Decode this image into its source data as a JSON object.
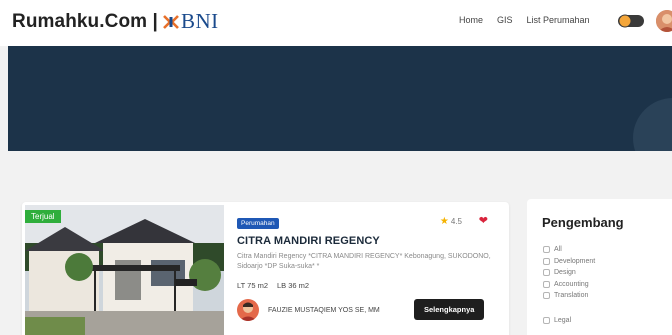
{
  "brand": {
    "name": "Rumahku.Com |",
    "partner": "BNI"
  },
  "nav": {
    "items": [
      "Home",
      "GIS",
      "List Perumahan"
    ]
  },
  "colors": {
    "hero": "#1c3349",
    "sold": "#2fae3c",
    "category": "#1f58b5",
    "button": "#1e1e1e",
    "heart": "#d9243c",
    "star": "#f5b301"
  },
  "listing": {
    "status": "Terjual",
    "category": "Perumahan",
    "rating": "4.5",
    "title": "CITRA MANDIRI REGENCY",
    "description": "Citra Mandiri Regency *CITRA MANDIRI REGENCY* Kebonagung, SUKODONO, Sidoarjo *DP Suka-suka* *",
    "lt": "LT 75 m2",
    "lb": "LB 36 m2",
    "agent": "FAUZIE MUSTAQIEM YOS SE, MM",
    "cta": "Selengkapnya"
  },
  "sidebar": {
    "title": "Pengembang",
    "filters": [
      "All",
      "Development",
      "Design",
      "Accounting",
      "Translation"
    ],
    "filters_more": [
      "Legal"
    ]
  },
  "icons": {
    "star": "star-icon",
    "heart": "heart-icon",
    "toggle": "theme-toggle-icon"
  }
}
